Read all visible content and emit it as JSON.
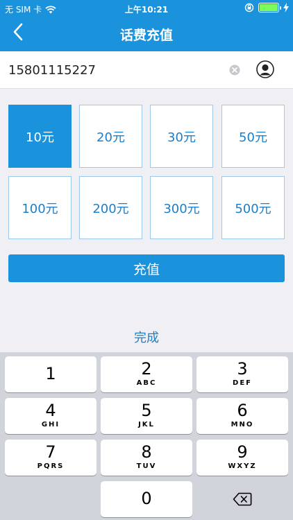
{
  "status_bar": {
    "carrier": "无 SIM 卡",
    "time": "上午10:21",
    "battery_level": 1.0
  },
  "nav": {
    "title": "话费充值",
    "back_icon": "chevron-left-icon"
  },
  "phone": {
    "value": "15801115227",
    "clear_icon": "clear-circle-icon",
    "contact_icon": "contact-person-icon"
  },
  "amounts": [
    "10元",
    "20元",
    "30元",
    "50元",
    "100元",
    "200元",
    "300元",
    "500元"
  ],
  "selected_amount": "10元",
  "recharge_label": "充值",
  "keyboard": {
    "done_label": "完成",
    "keys": [
      {
        "num": "1",
        "letters": ""
      },
      {
        "num": "2",
        "letters": "ABC"
      },
      {
        "num": "3",
        "letters": "DEF"
      },
      {
        "num": "4",
        "letters": "GHI"
      },
      {
        "num": "5",
        "letters": "JKL"
      },
      {
        "num": "6",
        "letters": "MNO"
      },
      {
        "num": "7",
        "letters": "PQRS"
      },
      {
        "num": "8",
        "letters": "TUV"
      },
      {
        "num": "9",
        "letters": "WXYZ"
      },
      {
        "num": "0",
        "letters": ""
      }
    ],
    "delete_icon": "backspace-icon"
  },
  "colors": {
    "primary": "#1b92dc",
    "amount_text": "#1b7fc9",
    "keypad_bg": "#d1d4da"
  }
}
